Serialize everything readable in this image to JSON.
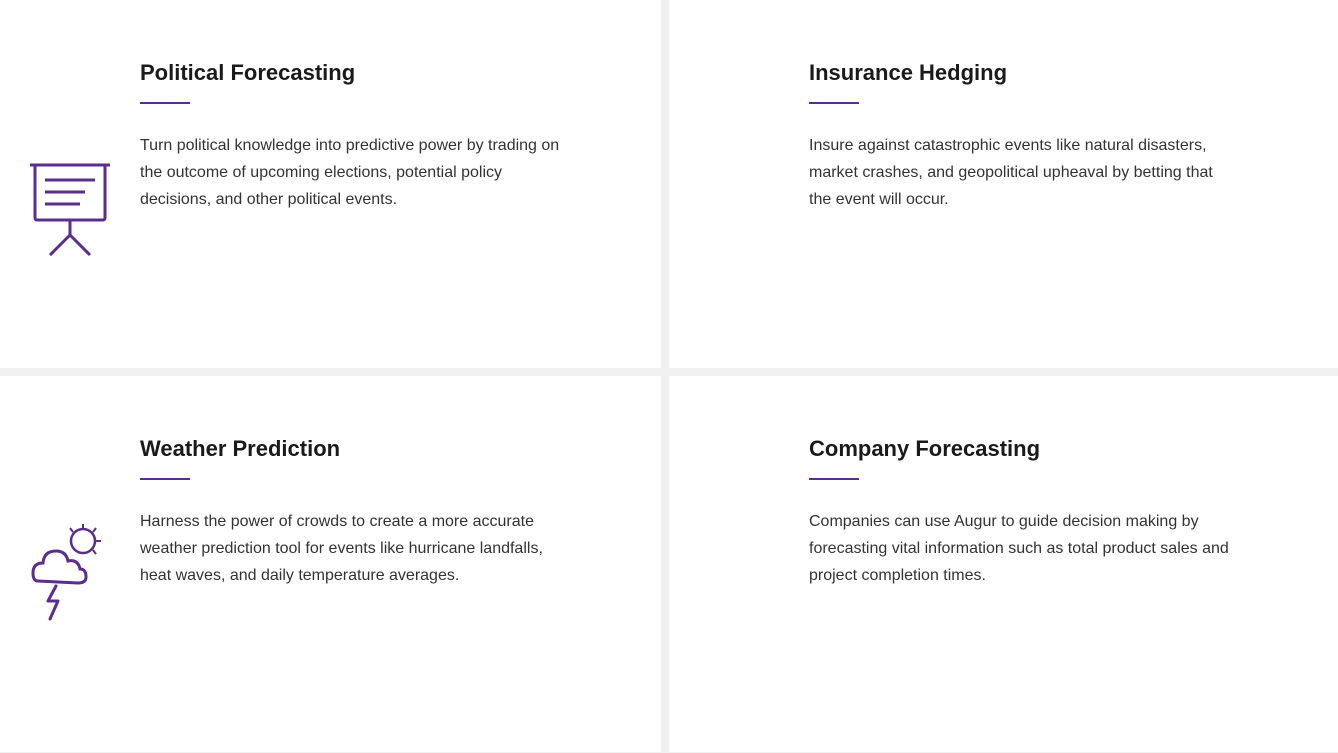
{
  "cells": [
    {
      "id": "political-forecasting",
      "title": "Political Forecasting",
      "description": "Turn political knowledge into predictive power by trading on the outcome of upcoming elections, potential policy decisions, and other political events.",
      "icon": "presentation-board"
    },
    {
      "id": "insurance-hedging",
      "title": "Insurance Hedging",
      "description": "Insure against catastrophic events like natural disasters, market crashes, and geopolitical upheaval by betting that the event will occur.",
      "icon": "dollar-shield"
    },
    {
      "id": "weather-prediction",
      "title": "Weather Prediction",
      "description": "Harness the power of crowds to create a more accurate weather prediction tool for events like hurricane landfalls, heat waves, and daily temperature averages.",
      "icon": "weather-cloud"
    },
    {
      "id": "company-forecasting",
      "title": "Company Forecasting",
      "description": "Companies can use Augur to guide decision making by forecasting vital information such as total product sales and project completion times.",
      "icon": "bar-chart"
    }
  ],
  "accent_color": "#5b2d8e"
}
